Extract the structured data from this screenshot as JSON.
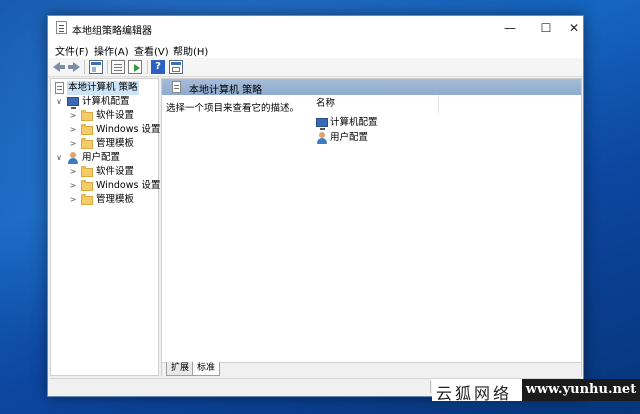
{
  "window": {
    "title": "本地组策略编辑器",
    "controls": {
      "minimize": "—",
      "maximize": "☐",
      "close": "✕"
    }
  },
  "menu": [
    "文件(F)",
    "操作(A)",
    "查看(V)",
    "帮助(H)"
  ],
  "toolbar": {
    "help_glyph": "?"
  },
  "tree": {
    "root": "本地计算机 策略",
    "computer_config": {
      "label": "计算机配置",
      "children": [
        "软件设置",
        "Windows 设置",
        "管理模板"
      ]
    },
    "user_config": {
      "label": "用户配置",
      "children": [
        "软件设置",
        "Windows 设置",
        "管理模板"
      ]
    },
    "chevron_open": "∨",
    "chevron_closed": ">"
  },
  "right": {
    "header_title": "本地计算机 策略",
    "description": "选择一个项目来查看它的描述。",
    "column_name": "名称",
    "items": [
      "计算机配置",
      "用户配置"
    ]
  },
  "tabs": [
    "扩展",
    "标准"
  ],
  "watermark": {
    "cn": "云狐网络",
    "url": "www.yunhu.net"
  }
}
